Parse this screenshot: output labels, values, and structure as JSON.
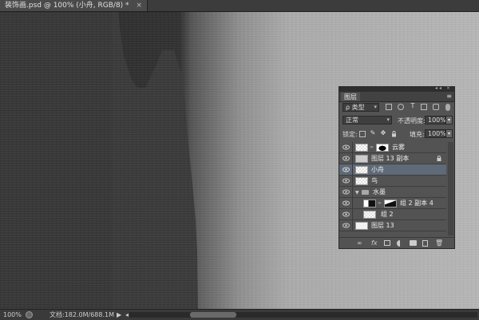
{
  "document": {
    "tab_title": "装饰画.psd @ 100% (小舟, RGB/8) *",
    "close_glyph": "×"
  },
  "status_bar": {
    "zoom": "100%",
    "doc_info": "文档:182.0M/688.1M",
    "arrow_glyph": "▶",
    "arrow_small_glyph": "◂"
  },
  "colors": {
    "canvas_dark": "#2e2e2e",
    "canvas_light": "#b6b6b6",
    "panel_bg": "#535353",
    "selected_row": "#5f6a78"
  },
  "layers_panel": {
    "title": "图层",
    "title_controls": "◂◂ ×",
    "menu_glyph": "≡",
    "filter": {
      "search_glyph": "ρ",
      "value": "类型"
    },
    "filter_icons": [
      "image-filter-icon",
      "adjustment-filter-icon",
      "type-filter-icon",
      "shape-filter-icon",
      "smart-object-filter-icon"
    ],
    "blend_mode": "正常",
    "opacity_label": "不透明度:",
    "opacity_value": "100%",
    "lock_label": "锁定:",
    "fill_label": "填充:",
    "fill_value": "100%",
    "stepper_glyph": "▾",
    "layers": [
      {
        "name": "云雾",
        "thumb": "checker",
        "mask": "cloud",
        "linked": true,
        "locked": false,
        "selected": false,
        "indent": false
      },
      {
        "name": "图层 13 副本",
        "thumb": "solid",
        "mask": null,
        "linked": false,
        "locked": true,
        "selected": false,
        "indent": false
      },
      {
        "name": "小舟",
        "thumb": "checker",
        "mask": null,
        "linked": false,
        "locked": false,
        "selected": true,
        "indent": false
      },
      {
        "name": "鸟",
        "thumb": "checker",
        "mask": null,
        "linked": false,
        "locked": false,
        "selected": false,
        "indent": false
      },
      {
        "name": "水墨",
        "thumb": null,
        "mask": null,
        "linked": false,
        "locked": false,
        "selected": false,
        "group": true,
        "indent": false
      },
      {
        "name": "组 2 副本 4",
        "thumb": "dark",
        "mask": "mtn",
        "linked": true,
        "locked": false,
        "selected": false,
        "indent": true
      },
      {
        "name": "组 2",
        "thumb": "checker",
        "mask": null,
        "linked": false,
        "locked": false,
        "selected": false,
        "indent": true
      },
      {
        "name": "图层 13",
        "thumb": "solid",
        "mask": null,
        "linked": false,
        "locked": false,
        "selected": false,
        "indent": false
      }
    ],
    "footer_icons": [
      "link-layers-icon",
      "fx-icon",
      "add-mask-icon",
      "adjustment-layer-icon",
      "new-group-icon",
      "new-layer-icon",
      "delete-layer-icon"
    ]
  }
}
